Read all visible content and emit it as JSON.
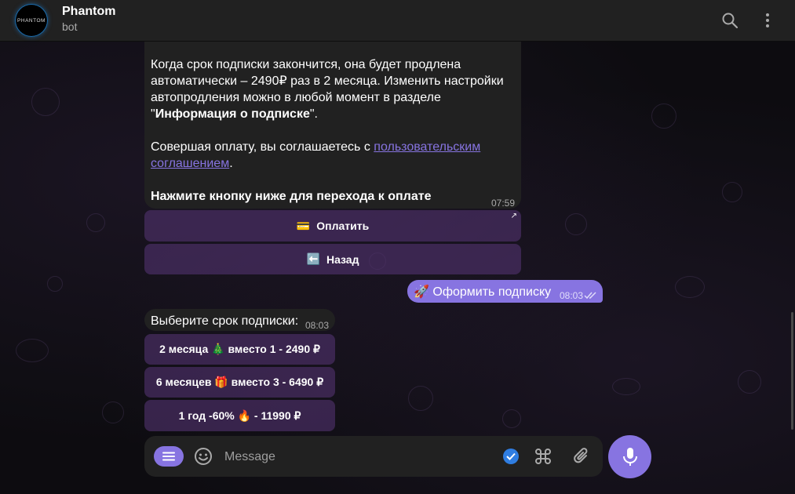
{
  "header": {
    "avatar_text": "PHANTOM",
    "name": "Phantom",
    "status": "bot"
  },
  "message1": {
    "para1": "Когда срок подписки закончится, она будет продлена автоматически – 2490₽ раз в 2 месяца. Изменить настройки автопродления можно в любой момент в разделе \"",
    "para1_bold": "Информация о подписке",
    "para1_end": "\".",
    "para2": "Совершая оплату, вы соглашаетесь с ",
    "para2_link": "пользовательским соглашением",
    "para2_end": ".",
    "para3_bold": "Нажмите кнопку ниже для перехода к оплате",
    "time": "07:59"
  },
  "keyboard1": {
    "pay": {
      "emoji": "💳",
      "label": "Оплатить",
      "arrow": "↗"
    },
    "back": {
      "emoji": "⬅️",
      "label": "Назад"
    }
  },
  "outgoing": {
    "emoji": "🚀",
    "text": "Оформить подписку",
    "time": "08:03"
  },
  "message2": {
    "text": "Выберите срок подписки:",
    "time": "08:03"
  },
  "keyboard2": {
    "opt1": "2 месяца 🎄  вместо 1 - 2490 ₽",
    "opt2": "6 месяцев 🎁  вместо 3 - 6490 ₽",
    "opt3": "1 год -60% 🔥  - 11990 ₽"
  },
  "composer": {
    "placeholder": "Message"
  },
  "colors": {
    "accent": "#8774e1",
    "bubble": "#212121",
    "keyboard_button": "#50326e",
    "header": "#212121"
  },
  "icons": [
    "search-icon",
    "more-vertical-icon",
    "menu-icon",
    "emoji-icon",
    "check-circle-icon",
    "command-icon",
    "attach-icon",
    "microphone-icon",
    "double-check-icon",
    "external-link-icon"
  ]
}
